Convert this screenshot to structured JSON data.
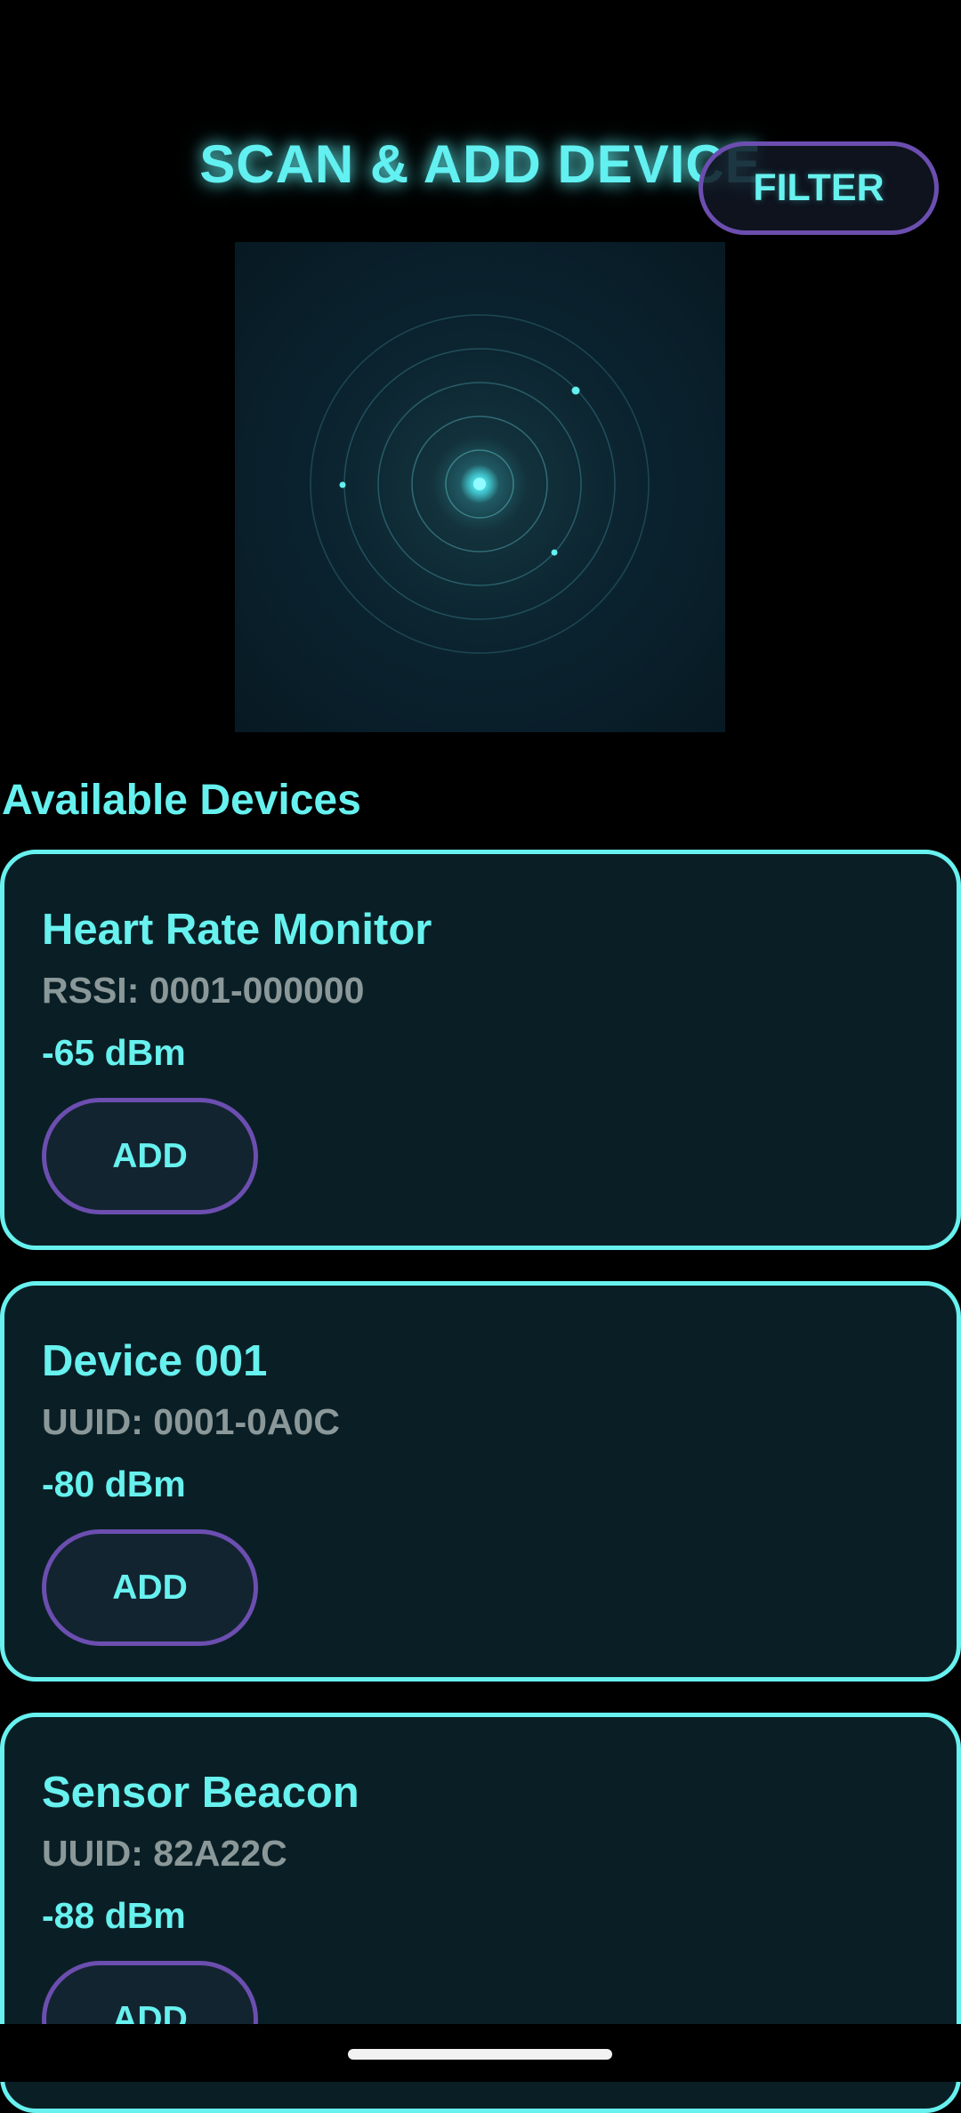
{
  "header": {
    "title": "SCAN & ADD DEVICE",
    "filter_label": "FILTER"
  },
  "radar": {
    "icon": "radar-scan-icon",
    "accent": "#5ce5ea"
  },
  "devices_section": {
    "title": "Available Devices",
    "items": [
      {
        "name": "Heart Rate Monitor",
        "identifier": "RSSI: 0001-000000",
        "signal": "-65 dBm",
        "add_label": "ADD"
      },
      {
        "name": "Device 001",
        "identifier": "UUID: 0001-0A0C",
        "signal": "-80 dBm",
        "add_label": "ADD"
      },
      {
        "name": "Sensor Beacon",
        "identifier": "UUID: 82A22C",
        "signal": "-88 dBm",
        "add_label": "ADD"
      }
    ]
  },
  "colors": {
    "accent": "#66f0ef",
    "button_border": "#6c4eb0",
    "card_bg": "#0a1f25",
    "muted_text": "#8b9899"
  }
}
